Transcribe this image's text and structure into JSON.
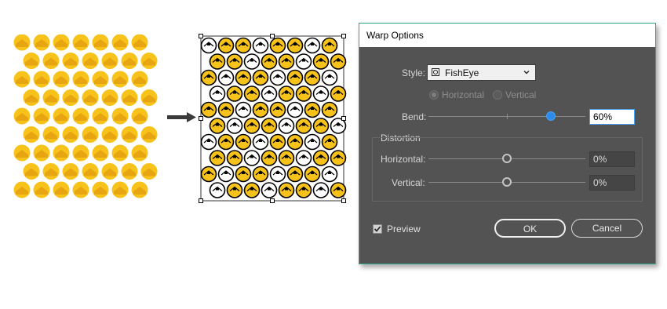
{
  "dialog": {
    "title": "Warp Options",
    "style": {
      "label": "Style:",
      "value": "FishEye",
      "icon": "fisheye-icon"
    },
    "orientation": {
      "options": [
        {
          "label": "Horizontal",
          "selected": true
        },
        {
          "label": "Vertical",
          "selected": false
        }
      ]
    },
    "bend": {
      "label": "Bend:",
      "value": "60%",
      "level": 0.6
    },
    "distortion": {
      "group_label": "Distortion",
      "horizontal": {
        "label": "Horizontal:",
        "value": "0%",
        "level": 0
      },
      "vertical": {
        "label": "Vertical:",
        "value": "0%",
        "level": 0
      }
    },
    "preview": {
      "label": "Preview",
      "checked": true
    },
    "buttons": {
      "ok": "OK",
      "cancel": "Cancel"
    }
  },
  "colors": {
    "dialog_bg": "#535353",
    "dialog_border": "#2fa58a",
    "accent_blue": "#2d8ceb",
    "scale_yellow": "#f7c31a",
    "scale_orange": "#e8a512"
  },
  "icons": [
    "arrow-right-icon",
    "fisheye-icon",
    "chevron-down-icon",
    "checkmark-icon"
  ]
}
